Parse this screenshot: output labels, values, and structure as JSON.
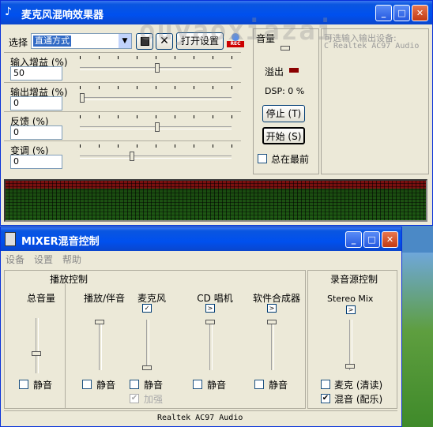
{
  "main_window": {
    "title": "麦克风混响效果器",
    "select_label": "选择",
    "mode_value": "直通方式",
    "open_settings": "打开设置",
    "rec_label": "REC",
    "sliders": [
      {
        "label": "输入增益 (%)",
        "value": "50",
        "level": 0.51
      },
      {
        "label": "输出增益 (%)",
        "value": "0",
        "level": 0.0
      },
      {
        "label": "反馈 (%)",
        "value": "0",
        "level": 0.51
      },
      {
        "label": "变调 (%)",
        "value": "0",
        "level": 0.34
      }
    ],
    "volume_label": "音量",
    "overflow_label": "溢出",
    "dsp_label": "DSP: 0 %",
    "stop_button": "停止 (T)",
    "start_button": "开始 (S)",
    "always_on_top": "总在最前",
    "device_heading": "可选输入输出设备:",
    "device_name": "C Realtek AC97 Audio",
    "watermark": "ouyaoxiazai"
  },
  "mixer": {
    "title": "MIXER混音控制",
    "menu": [
      "设备",
      "设置",
      "帮助"
    ],
    "playback_group": "播放控制",
    "record_group": "录音源控制",
    "channels": [
      {
        "name": "总音量",
        "mute": "静音",
        "level": 0.35
      },
      {
        "name": "播放/伴音",
        "mute": "静音",
        "level": 1.0
      },
      {
        "name": "麦克风",
        "mute": "静音",
        "level": 0.0,
        "extra": "加强"
      },
      {
        "name": "CD 唱机",
        "mute": "静音",
        "level": 1.0
      },
      {
        "name": "软件合成器",
        "mute": "静音",
        "level": 1.0
      }
    ],
    "stereo_mix": "Stereo Mix",
    "stereo_mix_level": 0.0,
    "record_mic": "麦克 (清读)",
    "record_mix": "混音 (配乐)",
    "status": "Realtek AC97 Audio"
  }
}
